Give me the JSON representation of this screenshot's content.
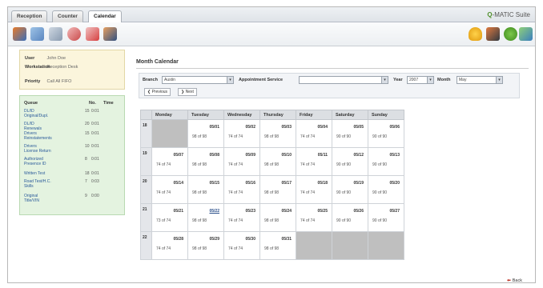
{
  "tabs": [
    "Reception",
    "Counter",
    "Calendar"
  ],
  "active_tab": "Calendar",
  "brand": {
    "mark": "Q",
    "name": "-MATIC Suite"
  },
  "toolbar_icons": [
    "queue-icon",
    "list-icon",
    "document-icon",
    "refresh-icon",
    "search-icon",
    "users-icon"
  ],
  "toolbar_right_icons": [
    "bell-icon",
    "user-settings-icon",
    "help-icon",
    "logout-icon"
  ],
  "info": {
    "user_label": "User",
    "user_value": "John Doe",
    "workstation_label": "Workstation",
    "workstation_value": "Reception Desk",
    "priority_label": "Priority",
    "priority_value": "Call All FIFO"
  },
  "queue": {
    "headers": [
      "Queue",
      "No.",
      "Time"
    ],
    "rows": [
      {
        "name": "DL/ID Original/Dupl.",
        "count": "15",
        "time": "0:01"
      },
      {
        "name": "DL/ID Renewals",
        "count": "20",
        "time": "0:01"
      },
      {
        "name": "Drivers Reinstatements",
        "count": "15",
        "time": "0:01"
      },
      {
        "name": "Drivers License Return",
        "count": "10",
        "time": "0:01"
      },
      {
        "name": "Authorized Presence ID",
        "count": "8",
        "time": "0:01"
      },
      {
        "name": "Written Test",
        "count": "18",
        "time": "0:01"
      },
      {
        "name": "Road Test/H.C. Skills",
        "count": "7",
        "time": "0:03"
      },
      {
        "name": "Original Title/VIN",
        "count": "9",
        "time": "0:00"
      }
    ]
  },
  "main": {
    "title": "Month Calendar",
    "branch_label": "Branch",
    "branch_value": "Austin",
    "service_label": "Appointment Service",
    "service_value": "",
    "year_label": "Year",
    "year_value": "2007",
    "month_label": "Month",
    "month_value": "May",
    "prev_label": "Previous",
    "next_label": "Next",
    "back_label": "Back"
  },
  "calendar": {
    "days": [
      "Monday",
      "Tuesday",
      "Wednesday",
      "Thursday",
      "Friday",
      "Saturday",
      "Sunday"
    ],
    "weeks": [
      {
        "wk": "18",
        "cells": [
          null,
          {
            "d": "05/01",
            "s": "98 of 98"
          },
          {
            "d": "05/02",
            "s": "74 of 74"
          },
          {
            "d": "05/03",
            "s": "98 of 98"
          },
          {
            "d": "05/04",
            "s": "74 of 74"
          },
          {
            "d": "05/05",
            "s": "90 of 90"
          },
          {
            "d": "05/06",
            "s": "90 of 90"
          }
        ]
      },
      {
        "wk": "19",
        "cells": [
          {
            "d": "05/07",
            "s": "74 of 74"
          },
          {
            "d": "05/08",
            "s": "98 of 98"
          },
          {
            "d": "05/09",
            "s": "74 of 74"
          },
          {
            "d": "05/10",
            "s": "98 of 98"
          },
          {
            "d": "05/11",
            "s": "74 of 74"
          },
          {
            "d": "05/12",
            "s": "90 of 90"
          },
          {
            "d": "05/13",
            "s": "90 of 90"
          }
        ]
      },
      {
        "wk": "20",
        "cells": [
          {
            "d": "05/14",
            "s": "74 of 74"
          },
          {
            "d": "05/15",
            "s": "98 of 98"
          },
          {
            "d": "05/16",
            "s": "74 of 74"
          },
          {
            "d": "05/17",
            "s": "98 of 98"
          },
          {
            "d": "05/18",
            "s": "74 of 74"
          },
          {
            "d": "05/19",
            "s": "90 of 90"
          },
          {
            "d": "05/20",
            "s": "90 of 90"
          }
        ]
      },
      {
        "wk": "21",
        "cells": [
          {
            "d": "05/21",
            "s": "73 of 74"
          },
          {
            "d": "05/22",
            "s": "98 of 98",
            "link": true
          },
          {
            "d": "05/23",
            "s": "74 of 74"
          },
          {
            "d": "05/24",
            "s": "98 of 98"
          },
          {
            "d": "05/25",
            "s": "74 of 74"
          },
          {
            "d": "05/26",
            "s": "90 of 90"
          },
          {
            "d": "05/27",
            "s": "90 of 90"
          }
        ]
      },
      {
        "wk": "22",
        "cells": [
          {
            "d": "05/28",
            "s": "74 of 74"
          },
          {
            "d": "05/29",
            "s": "98 of 98"
          },
          {
            "d": "05/30",
            "s": "74 of 74"
          },
          {
            "d": "05/31",
            "s": "98 of 98"
          },
          null,
          null,
          null
        ]
      }
    ]
  }
}
